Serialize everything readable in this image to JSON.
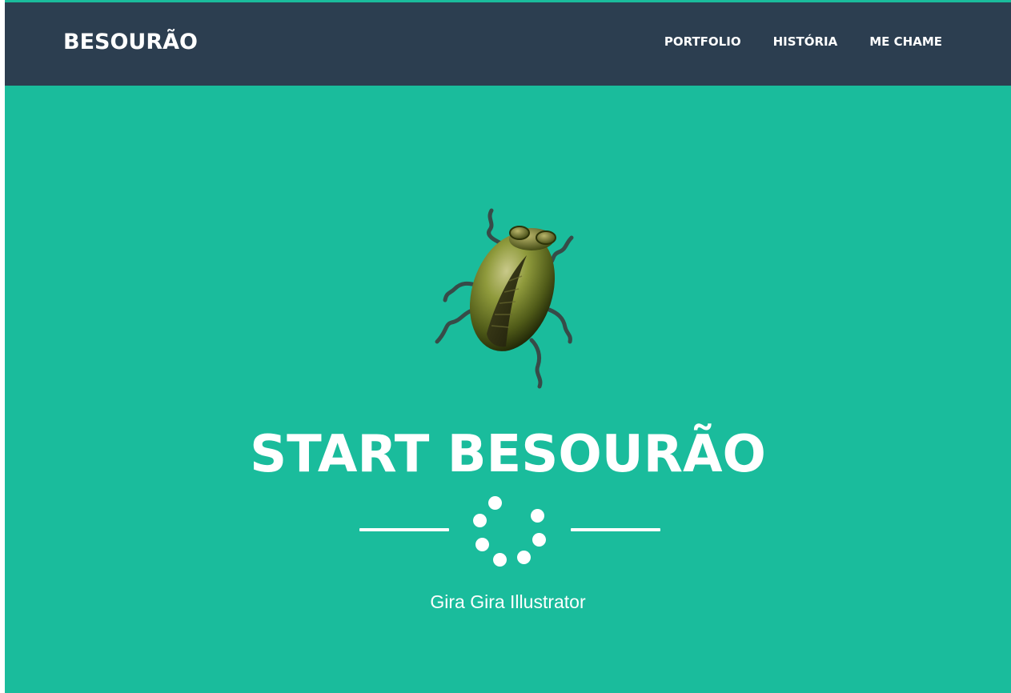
{
  "navbar": {
    "brand": "BESOURÃO",
    "links": [
      {
        "label": "PORTFOLIO"
      },
      {
        "label": "HISTÓRIA"
      },
      {
        "label": "ME CHAME"
      }
    ]
  },
  "masthead": {
    "image": "beetle-illustration",
    "title": "START BESOURÃO",
    "divider_icon": "loading-spinner-icon",
    "subtitle": "Gira Gira Illustrator"
  },
  "colors": {
    "primary": "#1abc9c",
    "navbar": "#2c3e50",
    "text": "#ffffff"
  }
}
